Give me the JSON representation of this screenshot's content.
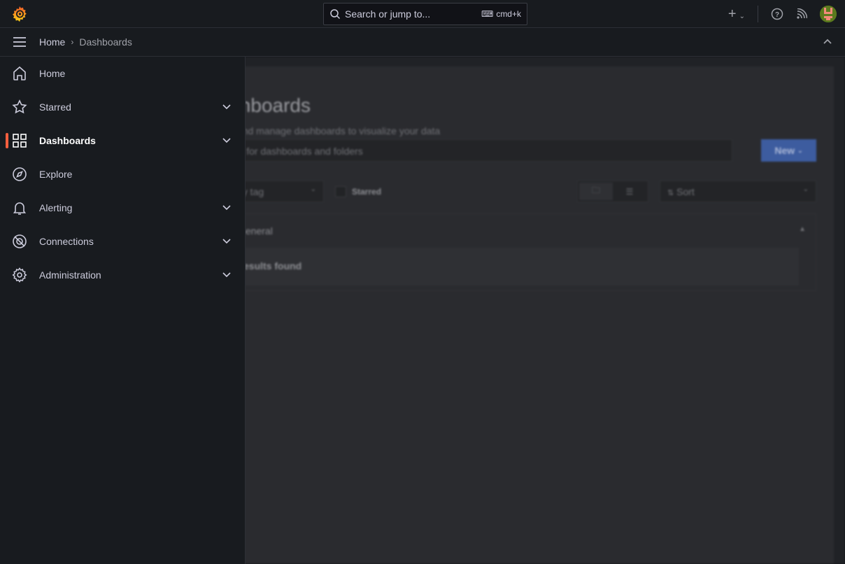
{
  "topbar": {
    "search_placeholder": "Search or jump to...",
    "shortcut": "cmd+k",
    "icons": [
      "grafana-logo",
      "plus-icon",
      "help-icon",
      "rss-icon",
      "avatar"
    ]
  },
  "breadcrumb": {
    "home": "Home",
    "current": "Dashboards"
  },
  "sidebar": {
    "items": [
      {
        "label": "Home",
        "icon": "home-icon",
        "expandable": false
      },
      {
        "label": "Starred",
        "icon": "star-icon",
        "expandable": true
      },
      {
        "label": "Dashboards",
        "icon": "apps-icon",
        "expandable": true,
        "active": true
      },
      {
        "label": "Explore",
        "icon": "compass-icon",
        "expandable": false
      },
      {
        "label": "Alerting",
        "icon": "bell-icon",
        "expandable": true
      },
      {
        "label": "Connections",
        "icon": "connections-icon",
        "expandable": true
      },
      {
        "label": "Administration",
        "icon": "gear-icon",
        "expandable": true
      }
    ]
  },
  "main": {
    "title": "Dashboards",
    "subtitle": "Create and manage dashboards to visualize your data",
    "search_placeholder": "Search for dashboards and folders",
    "new_label": "New",
    "tag_filter": "Filter by tag",
    "starred_label": "Starred",
    "sort_label": "Sort",
    "folder_name": "General",
    "empty_text": "No results found"
  },
  "colors": {
    "accent": "#f55f3e",
    "primary": "#3d71d9"
  }
}
